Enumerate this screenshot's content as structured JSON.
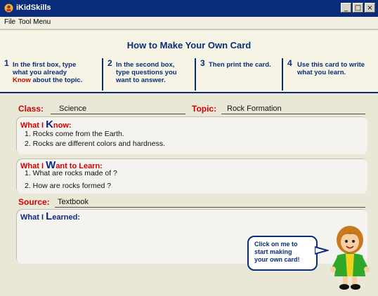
{
  "window": {
    "title": "iKidSkills"
  },
  "menu": [
    "File",
    "Tool Menu"
  ],
  "header": {
    "title": "How to Make Your Own Card"
  },
  "steps": [
    {
      "num": "1",
      "line1": "In the first box, type",
      "line2": "what you already",
      "line3_red": "Know",
      "line3_rest": " about the topic."
    },
    {
      "num": "2",
      "line1": "In the second box,",
      "line2": "type questions you",
      "line3": "want to answer."
    },
    {
      "num": "3",
      "line1": "Then print the card."
    },
    {
      "num": "4",
      "line1": "Use this card to write",
      "line2": "what you learn."
    }
  ],
  "card": {
    "class_label": "Class:",
    "class_value": "Science",
    "topic_label": "Topic:",
    "topic_value": "Rock Formation",
    "know": {
      "prefix": "What I ",
      "big": "K",
      "rest": "now:",
      "items": [
        "1. Rocks come from the Earth.",
        "2. Rocks are different colors and hardness."
      ]
    },
    "want": {
      "prefix": "What I ",
      "big": "W",
      "rest": "ant to Learn:",
      "items": [
        "1. What are rocks made of ?",
        "2. How are rocks formed ?"
      ]
    },
    "source_label": "Source:",
    "source_value": "Textbook",
    "learned": {
      "prefix": "What I ",
      "big": "L",
      "rest": "earned:"
    }
  },
  "helper": {
    "lines": [
      "Click on me to",
      "start making",
      "your own card!"
    ]
  }
}
